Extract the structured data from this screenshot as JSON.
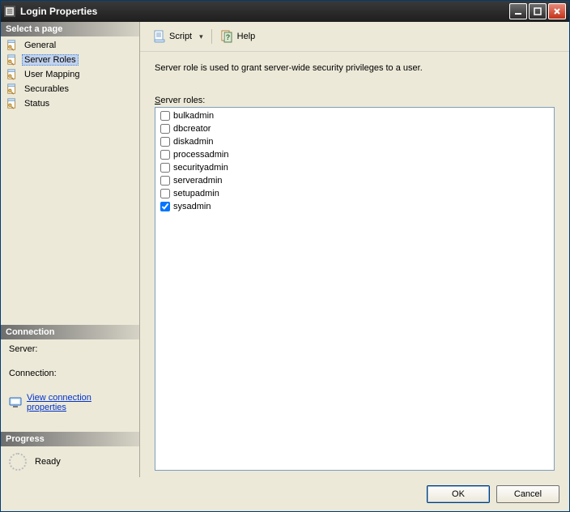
{
  "window": {
    "title": "Login Properties"
  },
  "left": {
    "select_page_header": "Select a page",
    "pages": [
      {
        "label": "General",
        "selected": false
      },
      {
        "label": "Server Roles",
        "selected": true
      },
      {
        "label": "User Mapping",
        "selected": false
      },
      {
        "label": "Securables",
        "selected": false
      },
      {
        "label": "Status",
        "selected": false
      }
    ],
    "connection_header": "Connection",
    "server_label": "Server:",
    "server_value": "",
    "connection_label": "Connection:",
    "connection_value": "",
    "view_conn_props": "View connection properties",
    "progress_header": "Progress",
    "progress_status": "Ready"
  },
  "toolbar": {
    "script_label": "Script",
    "help_label": "Help"
  },
  "content": {
    "description": "Server role is used to grant server-wide security privileges to a user.",
    "roles_label_prefix": "S",
    "roles_label_rest": "erver roles:",
    "roles": [
      {
        "label": "bulkadmin",
        "checked": false
      },
      {
        "label": "dbcreator",
        "checked": false
      },
      {
        "label": "diskadmin",
        "checked": false
      },
      {
        "label": "processadmin",
        "checked": false
      },
      {
        "label": "securityadmin",
        "checked": false
      },
      {
        "label": "serveradmin",
        "checked": false
      },
      {
        "label": "setupadmin",
        "checked": false
      },
      {
        "label": "sysadmin",
        "checked": true
      }
    ]
  },
  "footer": {
    "ok": "OK",
    "cancel": "Cancel"
  }
}
